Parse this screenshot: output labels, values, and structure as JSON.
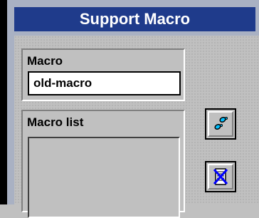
{
  "window": {
    "title": "Support Macro"
  },
  "macro": {
    "label": "Macro",
    "value": "old-macro"
  },
  "macro_list": {
    "label": "Macro list",
    "items": []
  },
  "toolbar": {
    "run_icon": "footprints-icon",
    "delete_icon": "delete-document-icon"
  },
  "colors": {
    "title_bar": "#1f3b8b",
    "frame": "#a9b1c3",
    "face": "#c0c0c0",
    "footprint": "#00c0ff",
    "delete_x": "#0000ff"
  }
}
